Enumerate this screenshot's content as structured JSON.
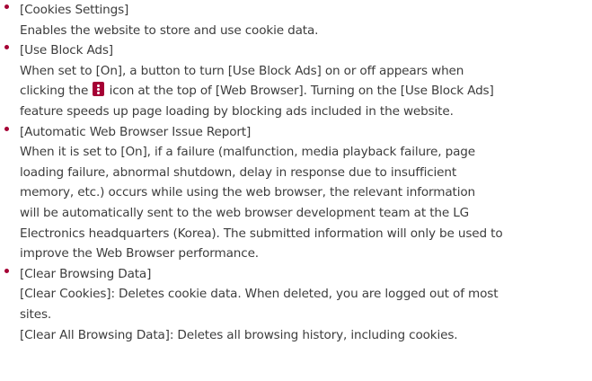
{
  "colors": {
    "bullet": "#a50034",
    "text": "#3c3c3c"
  },
  "items": [
    {
      "title": "[Cookies Settings]",
      "lines": [
        "Enables the website to store and use cookie data."
      ]
    },
    {
      "title": "[Use Block Ads]",
      "line1": "When set to [On], a button to turn [Use Block Ads] on or off appears when",
      "line2_before": "clicking the ",
      "icon": "vertical-dots-menu-icon",
      "line2_after": " icon at the top of [Web Browser]. Turning on the [Use Block Ads]",
      "line3": "feature speeds up page loading by blocking ads included in the website."
    },
    {
      "title": "[Automatic Web Browser Issue Report]",
      "lines": [
        "When it is set to [On], if a failure (malfunction, media playback failure, page",
        "loading failure, abnormal shutdown, delay in response due to insufficient",
        "memory, etc.) occurs while using the web browser, the relevant information",
        "will be automatically sent to the web browser development team at the LG",
        "Electronics headquarters (Korea). The submitted information will only be used to",
        "improve the Web Browser performance."
      ]
    },
    {
      "title": "[Clear Browsing Data]",
      "lines": [
        "[Clear Cookies]: Deletes cookie data. When deleted, you are logged out of most",
        "sites.",
        "[Clear All Browsing Data]: Deletes all browsing history, including cookies."
      ]
    }
  ]
}
